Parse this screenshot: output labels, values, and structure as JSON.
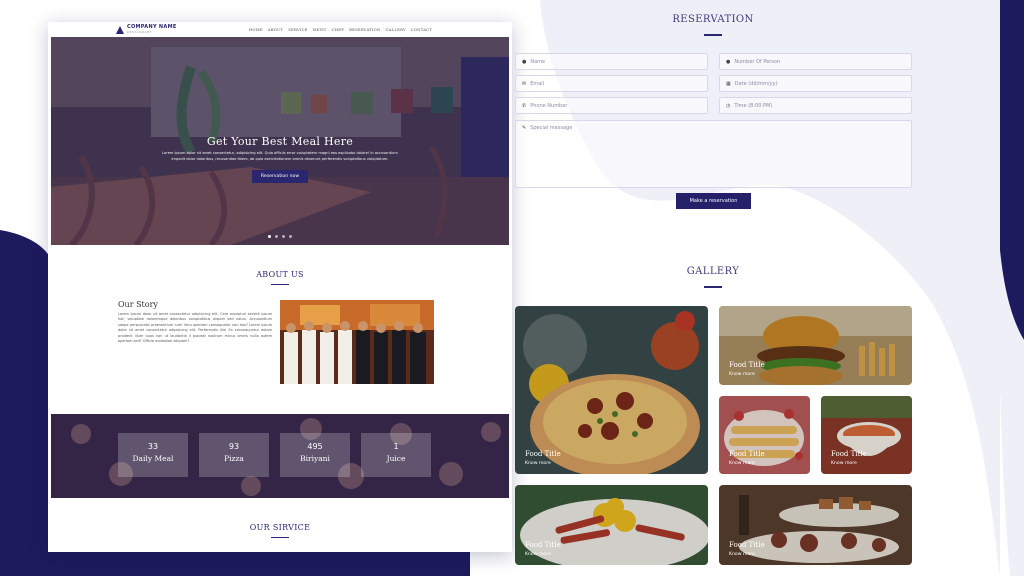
{
  "brand": {
    "name": "COMPANY NAME",
    "tagline": "RESTAURANT"
  },
  "nav": [
    "HOME",
    "ABOUT",
    "SERVICE",
    "MENU",
    "CHEF",
    "RESERVATION",
    "GALLERY",
    "CONTACT"
  ],
  "hero": {
    "title": "Get Your Best Meal Here",
    "text": "Lorem ipsum dolor sit amet consectetur, adipisicing elit. Quia officiis error voluptatem magni eos explicabo dolore! In accusantium impedit dolor doloribus, recusandae libero, ab quia exercitationem omnis deserunt perferendis voluptatibus voluptatum.",
    "button": "Reservation now",
    "slides": 4,
    "active_slide": 0
  },
  "about": {
    "title": "ABOUT US",
    "story_title": "Our Story",
    "story_text": "Lorem ipsum dolor sit amet consectetur adipisicing elit. Cere excepturi severit ipsum hat, voluptate doloremque doloribus voluptatibus aliquet sed natus. Accusantium saepe perspiciatis praesentium iure! Vero aperiam consequatur non eos? Lorem ipsum dolor sit amet consectetur adipisicing elit. Perferendis illo! Ex consequuntur dolore proident illum quas non ut laudantia il placeat nostrum minus omnis nulla autem aperiam sed? Officia molestiae aliquam?"
  },
  "stats": [
    {
      "value": "33",
      "label": "Daily Meal"
    },
    {
      "value": "93",
      "label": "Pizza"
    },
    {
      "value": "495",
      "label": "Biriyani"
    },
    {
      "value": "1",
      "label": "Juice"
    }
  ],
  "service": {
    "title": "OUR SIRVICE"
  },
  "reservation": {
    "title": "RESERVATION",
    "name": "Name",
    "persons": "Number Of Person",
    "email": "Email",
    "date": "Date (dd/mm/yy)",
    "phone": "Phone Number",
    "time": "Time (8:00 PM)",
    "message": "Special message",
    "button": "Make a reservation"
  },
  "gallery": {
    "title": "GALLERY",
    "items": [
      {
        "title": "Food Title",
        "link": "Know more"
      },
      {
        "title": "Food Title",
        "link": "Know more"
      },
      {
        "title": "Food Title",
        "link": "Know more"
      },
      {
        "title": "Food Title",
        "link": "Know more"
      },
      {
        "title": "Food Title",
        "link": "Know more"
      },
      {
        "title": "Food Title",
        "link": "Know more"
      }
    ]
  },
  "colors": {
    "accent": "#2a2670",
    "accent_dark": "#1c1860",
    "bg_shape": "#efeff8"
  }
}
